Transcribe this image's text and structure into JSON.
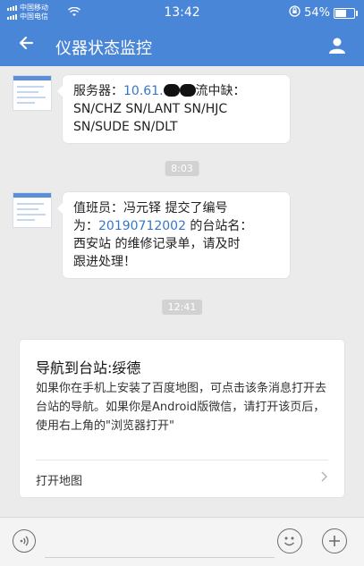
{
  "status_bar": {
    "carrier1": "中国移动",
    "carrier2": "中国电信",
    "time": "13:42",
    "battery": "54%",
    "battery_level": 0.54
  },
  "header": {
    "title": "仪器状态监控"
  },
  "messages": [
    {
      "prefix": "服务器：",
      "ip": "10.61.",
      "suffix": "流中缺：",
      "line2": "SN/CHZ SN/LANT SN/HJC",
      "line3": "SN/SUDE SN/DLT"
    },
    {
      "part1": "值班员：冯元铎 提交了编号",
      "part2": "为：",
      "number": "20190712002",
      "part3": " 的台站名：",
      "part4": "西安站 的维修记录单，请及时",
      "part5": "跟进处理！"
    }
  ],
  "timestamps": [
    "8:03",
    "12:41"
  ],
  "card": {
    "title": "导航到台站:绥德",
    "desc": "如果你在手机上安装了百度地图，可点击该条消息打开去台站的导航。如果你是Android版微信，请打开该页后，使用右上角的\"浏览器打开\"",
    "action": "打开地图"
  },
  "icons": {
    "back": "back-arrow-icon",
    "person": "person-icon",
    "voice": "voice-icon",
    "emoji": "emoji-icon",
    "plus": "plus-icon"
  }
}
